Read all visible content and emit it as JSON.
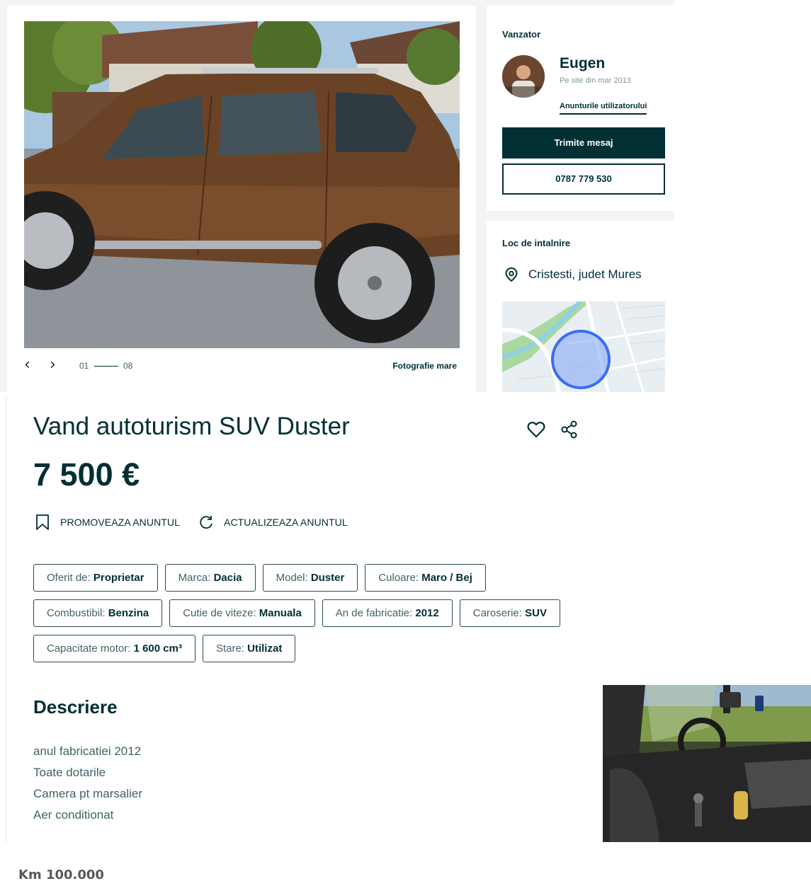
{
  "gallery": {
    "current": "01",
    "total": "08",
    "big_photo_link": "Fotografie mare",
    "prev_icon": "chevron-left-icon",
    "next_icon": "chevron-right-icon"
  },
  "seller": {
    "heading": "Vanzator",
    "name": "Eugen",
    "since": "Pe site din mar 2013",
    "ads_link": "Anunturile utilizatorului",
    "message_button": "Trimite mesaj",
    "phone_button": "0787 779 530"
  },
  "place": {
    "heading": "Loc de intalnire",
    "location": "Cristesti, judet Mures"
  },
  "listing": {
    "title": "Vand autoturism SUV Duster",
    "price": "7 500 €",
    "promote_label": "PROMOVEAZA ANUNTUL",
    "refresh_label": "ACTUALIZEAZA ANUNTUL"
  },
  "params": {
    "row1": [
      {
        "label": "Oferit de: ",
        "value": "Proprietar"
      },
      {
        "label": "Marca: ",
        "value": "Dacia"
      },
      {
        "label": "Model: ",
        "value": "Duster"
      },
      {
        "label": "Culoare: ",
        "value": "Maro / Bej"
      }
    ],
    "row2": [
      {
        "label": "Combustibil: ",
        "value": "Benzina"
      },
      {
        "label": "Cutie de viteze: ",
        "value": "Manuala"
      },
      {
        "label": "An de fabricatie: ",
        "value": "2012"
      },
      {
        "label": "Caroserie: ",
        "value": "SUV"
      }
    ],
    "row3": [
      {
        "label": "Capacitate motor: ",
        "value": "1 600 cm³"
      },
      {
        "label": "Stare: ",
        "value": "Utilizat"
      }
    ]
  },
  "description": {
    "heading": "Descriere",
    "lines": [
      "anul fabricatiei 2012",
      "Toate dotarile",
      "Camera pt marsalier",
      "Aer conditionat"
    ]
  },
  "footer": {
    "km": "Km 100.000"
  },
  "colors": {
    "primary": "#002f34",
    "muted": "#406367",
    "panel_bg": "#f2f4f5",
    "map_marker": "#3a6cf4"
  }
}
